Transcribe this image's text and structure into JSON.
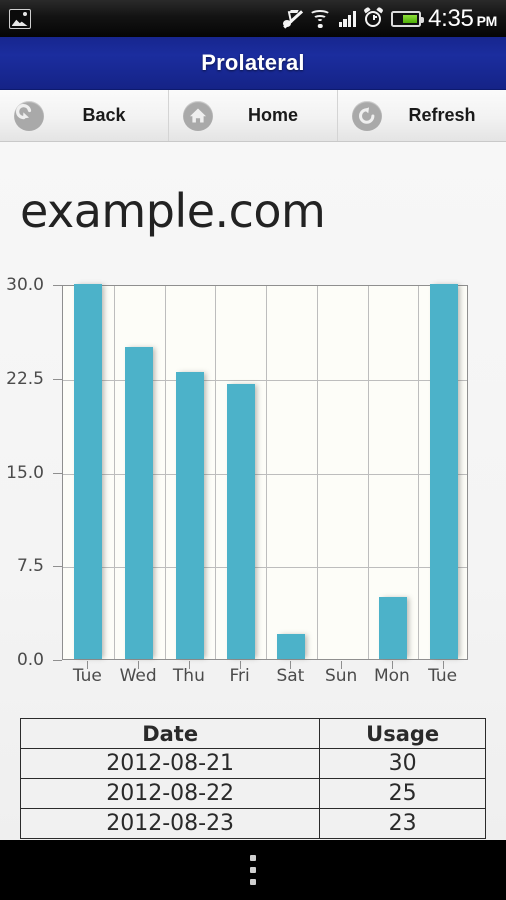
{
  "status_bar": {
    "notification_icon": "photo-icon",
    "icons": [
      "mute-icon",
      "wifi-icon",
      "signal-icon",
      "alarm-icon",
      "battery-icon"
    ],
    "battery_level_pct": 66,
    "time": "4:35",
    "meridiem": "PM"
  },
  "app": {
    "title": "Prolateral",
    "title_bar_color": "#1b2d9e"
  },
  "toolbar": {
    "buttons": [
      {
        "label": "Back",
        "icon": "back-arrow-icon"
      },
      {
        "label": "Home",
        "icon": "home-icon"
      },
      {
        "label": "Refresh",
        "icon": "refresh-icon"
      }
    ]
  },
  "page": {
    "heading": "example.com"
  },
  "chart_data": {
    "type": "bar",
    "title": "example.com",
    "categories": [
      "Tue",
      "Wed",
      "Thu",
      "Fri",
      "Sat",
      "Sun",
      "Mon",
      "Tue"
    ],
    "values": [
      30,
      25,
      23,
      22,
      2,
      0,
      5,
      30
    ],
    "xlabel": "",
    "ylabel": "",
    "ylim": [
      0,
      30
    ],
    "yticks": [
      "0.0",
      "7.5",
      "15.0",
      "22.5",
      "30.0"
    ],
    "ytick_values": [
      0,
      7.5,
      15,
      22.5,
      30
    ],
    "bar_color": "#4cb2c9",
    "grid": true,
    "legend": "none",
    "plot_background": "#fdfdf8"
  },
  "table": {
    "columns": [
      "Date",
      "Usage"
    ],
    "rows": [
      [
        "2012-08-21",
        "30"
      ],
      [
        "2012-08-22",
        "25"
      ],
      [
        "2012-08-23",
        "23"
      ]
    ]
  },
  "nav_bar": {
    "menu_icon": "overflow-menu-icon"
  }
}
